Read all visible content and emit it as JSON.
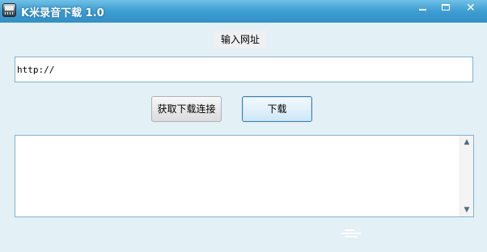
{
  "window": {
    "title": "K米录音下载 1.0",
    "app_icon": "app-icon",
    "controls": {
      "minimize": "minimize-icon",
      "maximize": "maximize-icon",
      "close": "close-icon",
      "close_glyph": "✕"
    }
  },
  "form": {
    "url_label": "输入网址",
    "url_value": "http://"
  },
  "buttons": {
    "get_link": "获取下载连接",
    "download": "下载"
  },
  "output": {
    "text": "",
    "scroll_up_glyph": "▲",
    "scroll_down_glyph": "▼"
  },
  "colors": {
    "titlebar_accent": "#3f9fd3",
    "background": "#e3f0f6",
    "field_border": "#7fb3cf"
  }
}
